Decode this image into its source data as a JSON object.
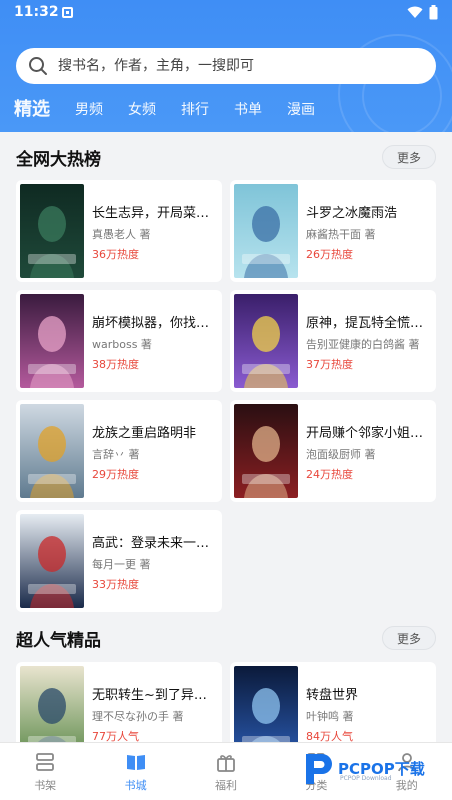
{
  "status": {
    "time": "11:32"
  },
  "search": {
    "placeholder": "搜书名，作者，主角，一搜即可"
  },
  "tabs": [
    "精选",
    "男频",
    "女频",
    "排行",
    "书单",
    "漫画"
  ],
  "sections": [
    {
      "title": "全网大热榜",
      "more": "更多"
    },
    {
      "title": "超人气精品",
      "more": "更多"
    }
  ],
  "hot_books": [
    {
      "title": "长生志异，开局菜…",
      "author": "真愚老人 著",
      "heat": "36万热度",
      "cover_colors": [
        "#0f2a22",
        "#1f4a3a",
        "#3a7a5c"
      ]
    },
    {
      "title": "斗罗之冰魔雨浩",
      "author": "麻酱热干面 著",
      "heat": "26万热度",
      "cover_colors": [
        "#7fc4d8",
        "#b7e3ee",
        "#3b6fa5"
      ]
    },
    {
      "title": "崩坏模拟器，你找…",
      "author": "warboss 著",
      "heat": "38万热度",
      "cover_colors": [
        "#3a1b3e",
        "#b45a9c",
        "#e8a3c8"
      ]
    },
    {
      "title": "原神，提瓦特全慌…",
      "author": "告别亚健康的白鸽酱 著",
      "heat": "37万热度",
      "cover_colors": [
        "#3a1f6a",
        "#8a5bd1",
        "#f2d24a"
      ]
    },
    {
      "title": "龙族之重启路明非",
      "author": "言辞丷 著",
      "heat": "29万热度",
      "cover_colors": [
        "#cfd9e2",
        "#5f7a8f",
        "#e0a12a"
      ]
    },
    {
      "title": "开局赚个邻家小姐…",
      "author": "泡面级厨师 著",
      "heat": "24万热度",
      "cover_colors": [
        "#2a0f12",
        "#8c1f22",
        "#e0b08a"
      ]
    },
    {
      "title": "高武：登录未来一…",
      "author": "每月一更 著",
      "heat": "33万热度",
      "cover_colors": [
        "#e6ecf2",
        "#1a2a4a",
        "#c92a2a"
      ]
    }
  ],
  "popular_books": [
    {
      "title": "无职转生~到了异…",
      "author": "理不尽な孙の手 著",
      "heat": "77万人气",
      "cover_colors": [
        "#e9e4cf",
        "#5c8a4a",
        "#2a4a6a"
      ]
    },
    {
      "title": "转盘世界",
      "author": "叶钟鸣 著",
      "heat": "84万人气",
      "cover_colors": [
        "#0b1a3a",
        "#2a5ab0",
        "#8fc4f0"
      ]
    }
  ],
  "bottom_nav": [
    {
      "label": "书架",
      "icon": "bookshelf-icon"
    },
    {
      "label": "书城",
      "icon": "bookstore-icon"
    },
    {
      "label": "福利",
      "icon": "gift-icon"
    },
    {
      "label": "分类",
      "icon": "category-icon"
    },
    {
      "label": "我的",
      "icon": "profile-icon"
    }
  ],
  "nav_active": "书城",
  "watermark": {
    "text": "PCPOP下载",
    "sub": "PCPOP Download"
  },
  "colors": {
    "primary": "#3f8ef5",
    "heat": "#e8473b"
  }
}
